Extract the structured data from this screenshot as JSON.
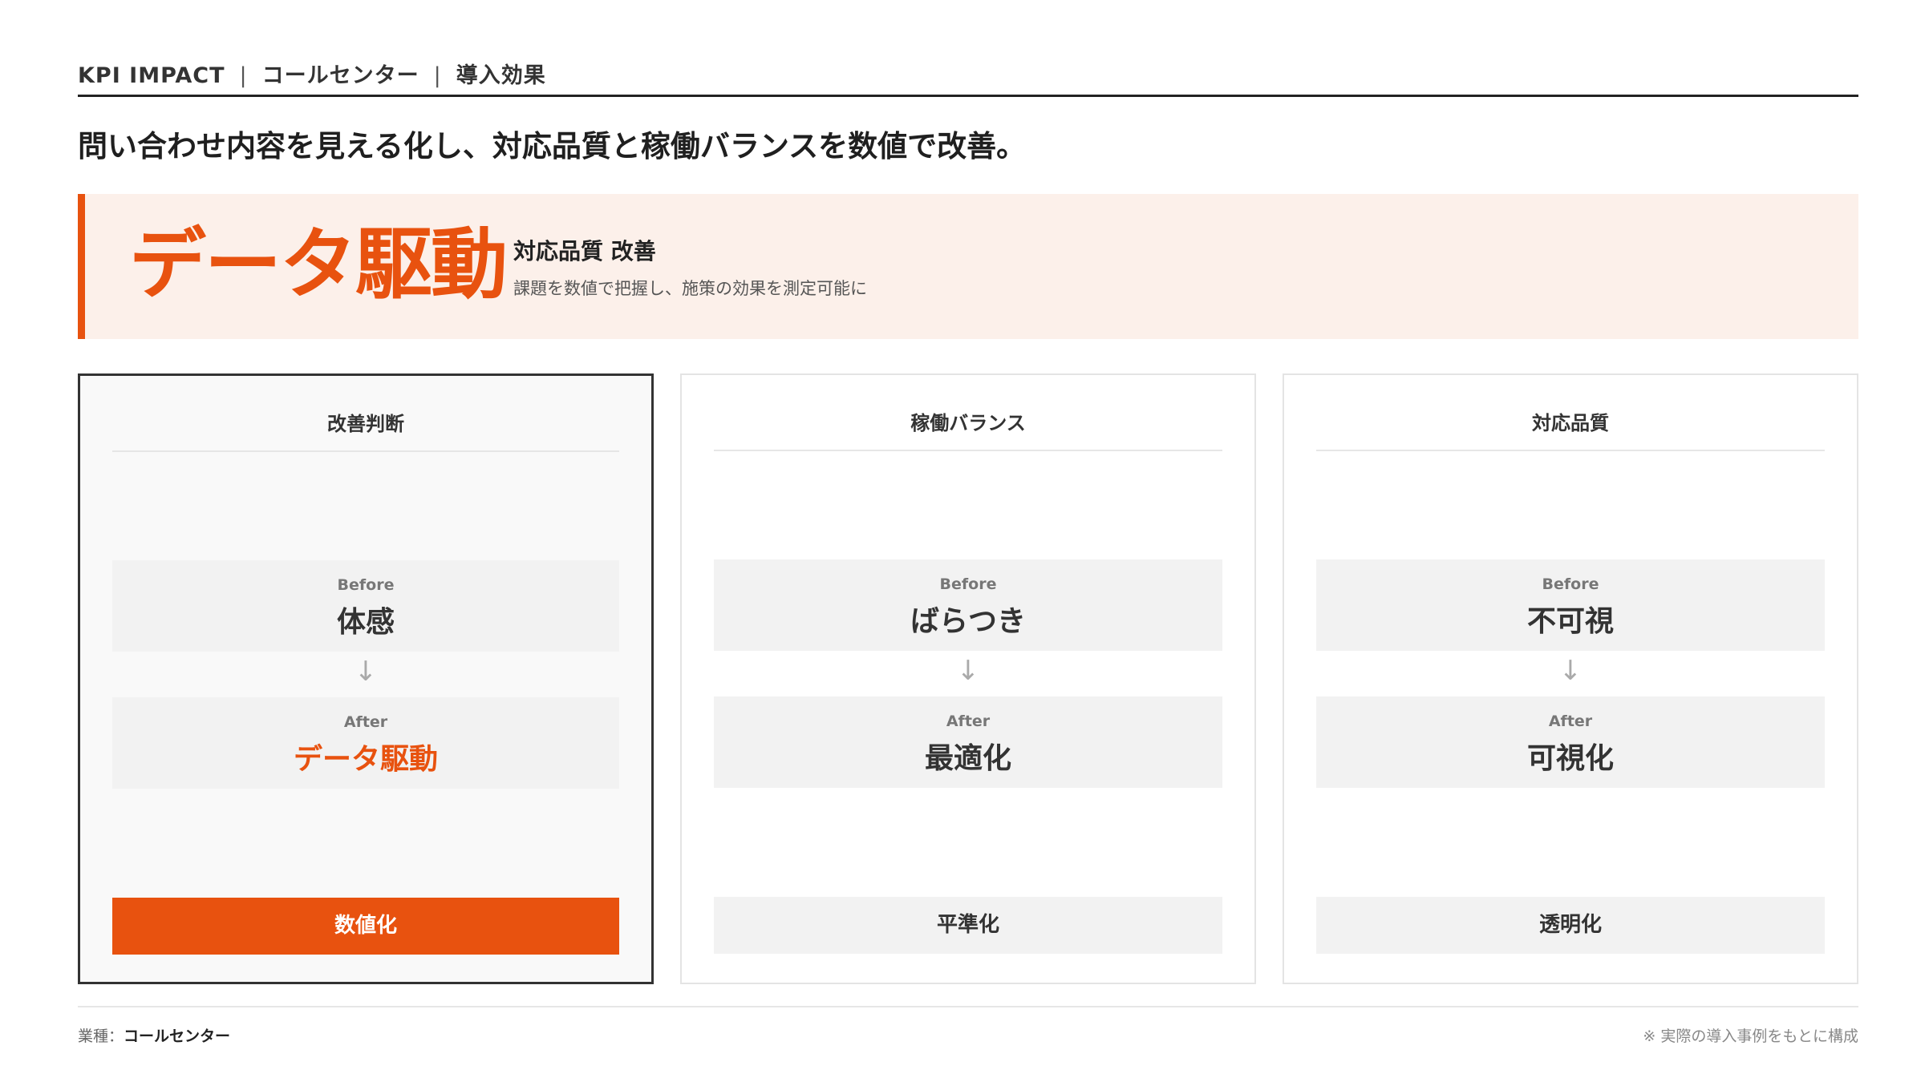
{
  "header": {
    "title": "KPI IMPACT",
    "separator": "|",
    "industry": "コールセンター",
    "section": "導入効果"
  },
  "headline": "問い合わせ内容を見える化し、対応品質と稼働バランスを数値で改善。",
  "hero": {
    "big_text": "データ駆動",
    "title": "対応品質 改善",
    "subtitle": "課題を数値で把握し、施策の効果を測定可能に"
  },
  "cards": [
    {
      "title": "改善判断",
      "before_label": "Before",
      "before_value": "体感",
      "arrow": "↓",
      "after_label": "After",
      "after_value": "データ駆動",
      "tag": "数値化"
    },
    {
      "title": "稼働バランス",
      "before_label": "Before",
      "before_value": "ばらつき",
      "arrow": "↓",
      "after_label": "After",
      "after_value": "最適化",
      "tag": "平準化"
    },
    {
      "title": "対応品質",
      "before_label": "Before",
      "before_value": "不可視",
      "arrow": "↓",
      "after_label": "After",
      "after_value": "可視化",
      "tag": "透明化"
    }
  ],
  "footer": {
    "industry_label": "業種：",
    "industry_value": "コールセンター",
    "note": "※ 実際の導入事例をもとに構成"
  },
  "colors": {
    "accent": "#e8520f",
    "hero_background": "#fcf0ea",
    "box_background": "#f2f2f2"
  }
}
